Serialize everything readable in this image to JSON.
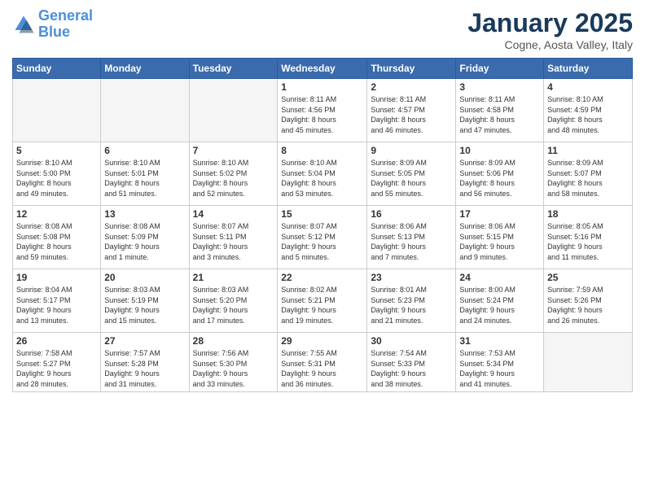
{
  "logo": {
    "line1": "General",
    "line2": "Blue"
  },
  "title": "January 2025",
  "location": "Cogne, Aosta Valley, Italy",
  "days_of_week": [
    "Sunday",
    "Monday",
    "Tuesday",
    "Wednesday",
    "Thursday",
    "Friday",
    "Saturday"
  ],
  "weeks": [
    [
      {
        "day": "",
        "info": ""
      },
      {
        "day": "",
        "info": ""
      },
      {
        "day": "",
        "info": ""
      },
      {
        "day": "1",
        "info": "Sunrise: 8:11 AM\nSunset: 4:56 PM\nDaylight: 8 hours\nand 45 minutes."
      },
      {
        "day": "2",
        "info": "Sunrise: 8:11 AM\nSunset: 4:57 PM\nDaylight: 8 hours\nand 46 minutes."
      },
      {
        "day": "3",
        "info": "Sunrise: 8:11 AM\nSunset: 4:58 PM\nDaylight: 8 hours\nand 47 minutes."
      },
      {
        "day": "4",
        "info": "Sunrise: 8:10 AM\nSunset: 4:59 PM\nDaylight: 8 hours\nand 48 minutes."
      }
    ],
    [
      {
        "day": "5",
        "info": "Sunrise: 8:10 AM\nSunset: 5:00 PM\nDaylight: 8 hours\nand 49 minutes."
      },
      {
        "day": "6",
        "info": "Sunrise: 8:10 AM\nSunset: 5:01 PM\nDaylight: 8 hours\nand 51 minutes."
      },
      {
        "day": "7",
        "info": "Sunrise: 8:10 AM\nSunset: 5:02 PM\nDaylight: 8 hours\nand 52 minutes."
      },
      {
        "day": "8",
        "info": "Sunrise: 8:10 AM\nSunset: 5:04 PM\nDaylight: 8 hours\nand 53 minutes."
      },
      {
        "day": "9",
        "info": "Sunrise: 8:09 AM\nSunset: 5:05 PM\nDaylight: 8 hours\nand 55 minutes."
      },
      {
        "day": "10",
        "info": "Sunrise: 8:09 AM\nSunset: 5:06 PM\nDaylight: 8 hours\nand 56 minutes."
      },
      {
        "day": "11",
        "info": "Sunrise: 8:09 AM\nSunset: 5:07 PM\nDaylight: 8 hours\nand 58 minutes."
      }
    ],
    [
      {
        "day": "12",
        "info": "Sunrise: 8:08 AM\nSunset: 5:08 PM\nDaylight: 8 hours\nand 59 minutes."
      },
      {
        "day": "13",
        "info": "Sunrise: 8:08 AM\nSunset: 5:09 PM\nDaylight: 9 hours\nand 1 minute."
      },
      {
        "day": "14",
        "info": "Sunrise: 8:07 AM\nSunset: 5:11 PM\nDaylight: 9 hours\nand 3 minutes."
      },
      {
        "day": "15",
        "info": "Sunrise: 8:07 AM\nSunset: 5:12 PM\nDaylight: 9 hours\nand 5 minutes."
      },
      {
        "day": "16",
        "info": "Sunrise: 8:06 AM\nSunset: 5:13 PM\nDaylight: 9 hours\nand 7 minutes."
      },
      {
        "day": "17",
        "info": "Sunrise: 8:06 AM\nSunset: 5:15 PM\nDaylight: 9 hours\nand 9 minutes."
      },
      {
        "day": "18",
        "info": "Sunrise: 8:05 AM\nSunset: 5:16 PM\nDaylight: 9 hours\nand 11 minutes."
      }
    ],
    [
      {
        "day": "19",
        "info": "Sunrise: 8:04 AM\nSunset: 5:17 PM\nDaylight: 9 hours\nand 13 minutes."
      },
      {
        "day": "20",
        "info": "Sunrise: 8:03 AM\nSunset: 5:19 PM\nDaylight: 9 hours\nand 15 minutes."
      },
      {
        "day": "21",
        "info": "Sunrise: 8:03 AM\nSunset: 5:20 PM\nDaylight: 9 hours\nand 17 minutes."
      },
      {
        "day": "22",
        "info": "Sunrise: 8:02 AM\nSunset: 5:21 PM\nDaylight: 9 hours\nand 19 minutes."
      },
      {
        "day": "23",
        "info": "Sunrise: 8:01 AM\nSunset: 5:23 PM\nDaylight: 9 hours\nand 21 minutes."
      },
      {
        "day": "24",
        "info": "Sunrise: 8:00 AM\nSunset: 5:24 PM\nDaylight: 9 hours\nand 24 minutes."
      },
      {
        "day": "25",
        "info": "Sunrise: 7:59 AM\nSunset: 5:26 PM\nDaylight: 9 hours\nand 26 minutes."
      }
    ],
    [
      {
        "day": "26",
        "info": "Sunrise: 7:58 AM\nSunset: 5:27 PM\nDaylight: 9 hours\nand 28 minutes."
      },
      {
        "day": "27",
        "info": "Sunrise: 7:57 AM\nSunset: 5:28 PM\nDaylight: 9 hours\nand 31 minutes."
      },
      {
        "day": "28",
        "info": "Sunrise: 7:56 AM\nSunset: 5:30 PM\nDaylight: 9 hours\nand 33 minutes."
      },
      {
        "day": "29",
        "info": "Sunrise: 7:55 AM\nSunset: 5:31 PM\nDaylight: 9 hours\nand 36 minutes."
      },
      {
        "day": "30",
        "info": "Sunrise: 7:54 AM\nSunset: 5:33 PM\nDaylight: 9 hours\nand 38 minutes."
      },
      {
        "day": "31",
        "info": "Sunrise: 7:53 AM\nSunset: 5:34 PM\nDaylight: 9 hours\nand 41 minutes."
      },
      {
        "day": "",
        "info": ""
      }
    ]
  ]
}
